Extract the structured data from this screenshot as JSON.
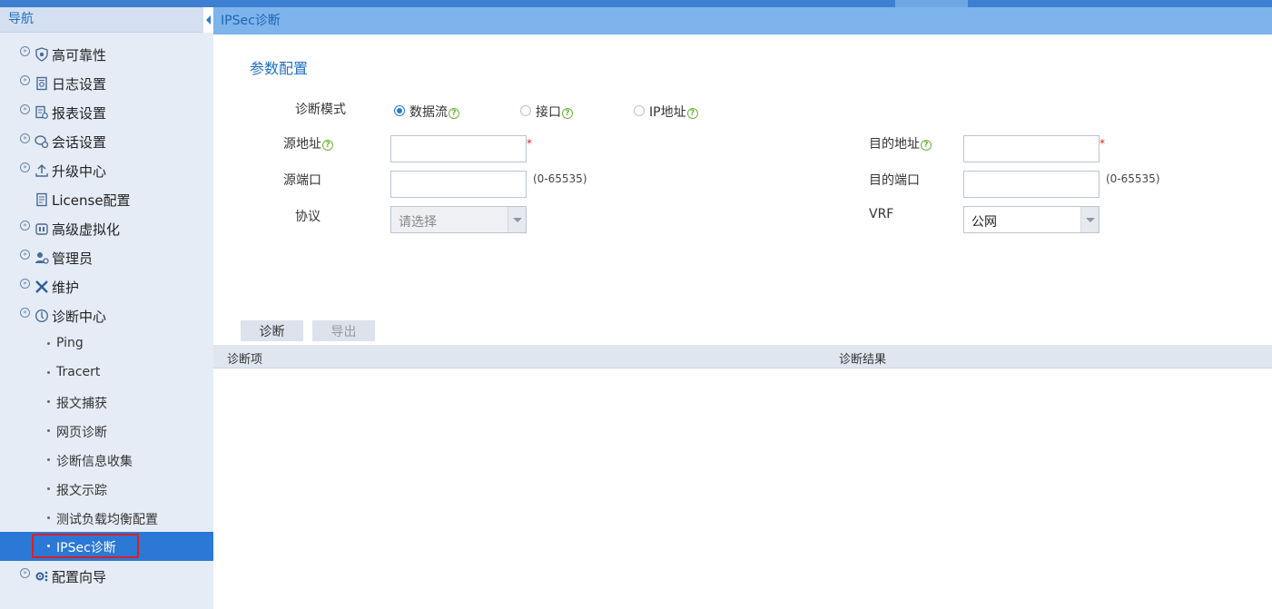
{
  "sidebar": {
    "header": "导航",
    "items": [
      {
        "label": "高可靠性",
        "icon": "shield-icon"
      },
      {
        "label": "日志设置",
        "icon": "log-icon"
      },
      {
        "label": "报表设置",
        "icon": "report-icon"
      },
      {
        "label": "会话设置",
        "icon": "session-icon"
      },
      {
        "label": "升级中心",
        "icon": "upload-icon"
      },
      {
        "label": "License配置",
        "icon": "license-icon"
      },
      {
        "label": "高级虚拟化",
        "icon": "virtualization-icon"
      },
      {
        "label": "管理员",
        "icon": "admin-icon"
      },
      {
        "label": "维护",
        "icon": "tools-icon"
      },
      {
        "label": "诊断中心",
        "icon": "diagnosis-icon"
      }
    ],
    "subitems": [
      "Ping",
      "Tracert",
      "报文捕获",
      "网页诊断",
      "诊断信息收集",
      "报文示踪",
      "测试负载均衡配置",
      "IPSec诊断"
    ],
    "active_subitem": "IPSec诊断",
    "last_item": {
      "label": "配置向导",
      "icon": "wizard-icon"
    }
  },
  "breadcrumb": "IPSec诊断",
  "section_title": "参数配置",
  "form": {
    "mode_label": "诊断模式",
    "modes": [
      "数据流",
      "接口",
      "IP地址"
    ],
    "selected_mode": "数据流",
    "src_addr_label": "源地址",
    "src_addr_value": "",
    "dst_addr_label": "目的地址",
    "dst_addr_value": "",
    "src_port_label": "源端口",
    "src_port_value": "",
    "dst_port_label": "目的端口",
    "dst_port_value": "",
    "port_range": "(0-65535)",
    "protocol_label": "协议",
    "protocol_placeholder": "请选择",
    "vrf_label": "VRF",
    "vrf_value": "公网",
    "required_mark": "*",
    "help_glyph": "?"
  },
  "buttons": {
    "diagnose": "诊断",
    "export": "导出"
  },
  "results": {
    "columns": [
      "诊断项",
      "诊断结果"
    ],
    "rows": []
  },
  "colors": {
    "accent": "#2b78d6",
    "header_bar": "#7db4ec",
    "sidebar_bg": "#e6ecf6",
    "highlight": "#e01e1e"
  }
}
